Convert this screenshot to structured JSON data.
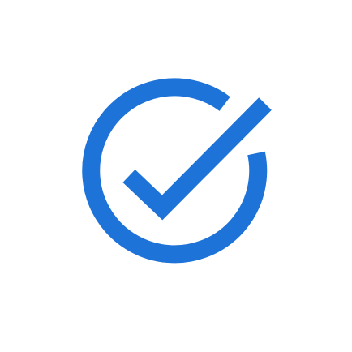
{
  "icon": {
    "name": "circle-check-icon",
    "accent_color": "#1E73D8",
    "background_color": "#FFFFFF"
  }
}
